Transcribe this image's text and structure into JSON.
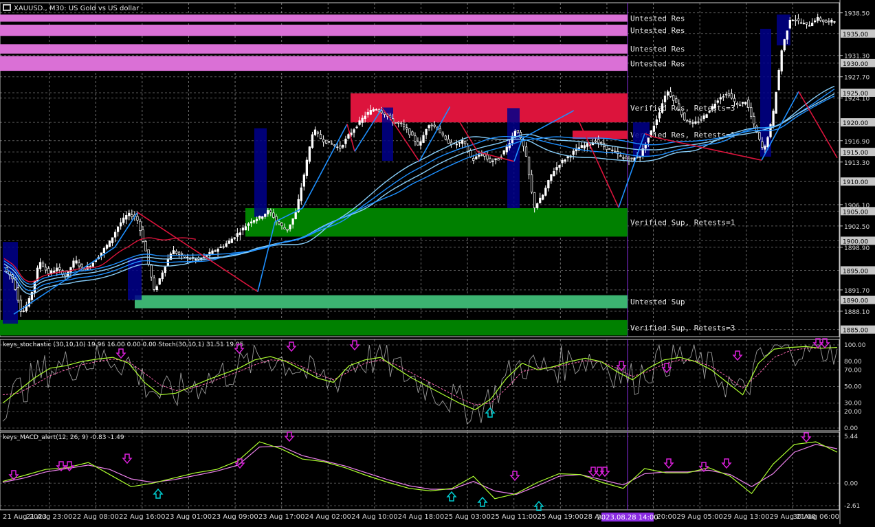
{
  "header": {
    "symbol_line": "XAUUSD., M30:  US Gold vs US dollar"
  },
  "colors": {
    "background": "#000000",
    "grid": "#c8c8c8",
    "candle": "#ffffff",
    "zone_untested_res": "#da70d6",
    "zone_verified_res": "#dc143c",
    "zone_verified_sup": "#008000",
    "zone_untested_sup": "#3cb371",
    "zigzag_up": "#1e90ff",
    "zigzag_down": "#dc143c",
    "ma_blue": "#1e90ff",
    "ma_light": "#87cefa",
    "ma_red": "#dc143c",
    "highlight_box": "#00008b",
    "stoch_main": "#adff2f",
    "stoch_signal": "#ff69b4",
    "stoch_raw": "#c0c0c0",
    "macd_main": "#adff2f",
    "macd_signal": "#ee82ee",
    "arrow_down": "#da20da",
    "arrow_up": "#00ced1",
    "price_label_bg": "#c8c8c8",
    "time_highlight": "#8a2be2"
  },
  "chart_data": [
    {
      "type": "candlestick",
      "title": "XAUUSD., M30:  US Gold vs US dollar",
      "ylim": [
        1883.8,
        1940.2
      ],
      "y_tick_labels": [
        "1938.50",
        "1935.00",
        "1931.30",
        "1930.00",
        "1927.70",
        "1925.00",
        "1924.10",
        "1920.00",
        "1916.90",
        "1915.00",
        "1913.30",
        "1910.00",
        "1906.10",
        "1905.00",
        "1902.50",
        "1900.00",
        "1898.90",
        "1895.00",
        "1891.70",
        "1890.00",
        "1888.10",
        "1885.00"
      ],
      "x_tick_labels": [
        "21 Aug 2023",
        "21 Aug 23:00",
        "22 Aug 08:00",
        "22 Aug 16:00",
        "23 Aug 01:00",
        "23 Aug 09:00",
        "23 Aug 17:00",
        "24 Aug 02:00",
        "24 Aug 10:00",
        "24 Aug 18:00",
        "25 Aug 03:00",
        "25 Aug 11:00",
        "25 Aug 19:00",
        "28 Aug 04:00",
        "28 Aug 20:00",
        "29 Aug 05:00",
        "29 Aug 13:00",
        "29 Aug 21:00",
        "30 Aug 06:00"
      ],
      "highlighted_time_label": "2023.08.28 14:00",
      "zones": [
        {
          "label": "Untested Res",
          "low": 1937.0,
          "high": 1938.2,
          "kind": "untested_res"
        },
        {
          "label": "Untested Res",
          "low": 1934.6,
          "high": 1936.5,
          "kind": "untested_res"
        },
        {
          "label": "Untested Res",
          "low": 1931.6,
          "high": 1933.2,
          "kind": "untested_res"
        },
        {
          "label": "Untested Res",
          "low": 1928.7,
          "high": 1931.2,
          "kind": "untested_res"
        },
        {
          "label": "Verified Res, Retests=3",
          "low": 1920.0,
          "high": 1924.9,
          "kind": "verified_res"
        },
        {
          "label": "Verified Res, Retests=1",
          "low": 1917.2,
          "high": 1918.6,
          "kind": "verified_res"
        },
        {
          "label": "Verified Sup, Retests=1",
          "low": 1900.7,
          "high": 1905.5,
          "kind": "verified_sup"
        },
        {
          "label": "Untested Sup",
          "low": 1888.6,
          "high": 1890.8,
          "kind": "untested_sup"
        },
        {
          "label": "Verified Sup, Retests=3",
          "low": 1884.0,
          "high": 1886.6,
          "kind": "verified_sup"
        }
      ],
      "price_path": [
        1895.5,
        1893.5,
        1887.6,
        1890.5,
        1896.6,
        1894.5,
        1895.3,
        1894.0,
        1896.8,
        1895.0,
        1896.2,
        1898.0,
        1899.9,
        1902.7,
        1904.5,
        1904.0,
        1898.5,
        1891.4,
        1895.0,
        1898.4,
        1897.5,
        1897.0,
        1896.8,
        1897.6,
        1898.5,
        1899.3,
        1900.6,
        1902.0,
        1903.4,
        1904.0,
        1905.1,
        1903.0,
        1901.7,
        1904.6,
        1911.5,
        1918.9,
        1917.0,
        1916.4,
        1915.6,
        1917.8,
        1919.6,
        1921.4,
        1922.4,
        1921.6,
        1920.1,
        1919.6,
        1918.0,
        1916.0,
        1919.8,
        1919.1,
        1916.9,
        1916.2,
        1916.8,
        1913.5,
        1914.8,
        1913.4,
        1913.8,
        1916.0,
        1919.1,
        1915.0,
        1905.6,
        1907.7,
        1911.4,
        1913.2,
        1914.4,
        1915.7,
        1916.2,
        1916.9,
        1915.8,
        1915.1,
        1914.0,
        1913.7,
        1914.4,
        1917.6,
        1921.0,
        1925.4,
        1923.5,
        1920.5,
        1919.7,
        1920.6,
        1922.3,
        1924.3,
        1924.8,
        1922.8,
        1923.6,
        1919.0,
        1915.0,
        1920.8,
        1932.0,
        1937.6,
        1937.0,
        1936.3,
        1937.6,
        1936.9,
        1937.1
      ],
      "zigzag_points": [
        [
          1887.6,
          1898.9
        ],
        [
          1904.8,
          1891.4
        ],
        [
          1903.2,
          1905.5
        ],
        [
          1919.7,
          1915.1
        ],
        [
          1922.4,
          1920.0
        ],
        [
          1913.4,
          1922.7
        ],
        [
          1915.0,
          1913.4
        ],
        [
          1917.3,
          1922.0
        ],
        [
          1905.6,
          1918.1
        ],
        [
          1917.5,
          1913.6
        ],
        [
          1925.2,
          1914.0
        ],
        [
          1938.0,
          1935.9
        ]
      ]
    },
    {
      "type": "line",
      "title": "keys_stochastic (30,10,10) 19.96 16.00 0.00 0.00 Stoch(30,10,1) 31.51 19.95",
      "ylim": [
        0,
        100
      ],
      "y_tick_labels": [
        "100.00",
        "80.00",
        "70.00",
        "50.00",
        "30.00",
        "20.00",
        "0.00"
      ],
      "series": [
        {
          "name": "main",
          "values": [
            30,
            45,
            60,
            72,
            75,
            80,
            83,
            85,
            78,
            55,
            40,
            42,
            50,
            58,
            65,
            72,
            82,
            86,
            80,
            70,
            60,
            55,
            75,
            82,
            85,
            72,
            60,
            50,
            40,
            30,
            22,
            35,
            60,
            78,
            70,
            74,
            80,
            84,
            80,
            68,
            58,
            72,
            82,
            85,
            80,
            70,
            55,
            40,
            78,
            95,
            97,
            98,
            96,
            97
          ]
        },
        {
          "name": "signal",
          "values": [
            40,
            42,
            52,
            63,
            70,
            76,
            80,
            83,
            80,
            66,
            52,
            45,
            48,
            54,
            61,
            68,
            76,
            82,
            81,
            74,
            65,
            58,
            68,
            78,
            82,
            76,
            66,
            56,
            46,
            36,
            28,
            30,
            48,
            68,
            72,
            73,
            77,
            81,
            80,
            72,
            62,
            68,
            77,
            82,
            81,
            74,
            62,
            48,
            65,
            85,
            93,
            96,
            96,
            97
          ]
        }
      ],
      "down_arrow_count": 12,
      "up_arrow_count": 1
    },
    {
      "type": "line",
      "title": "keys_MACD_alert(12, 26, 9) -0.83 -1.49",
      "ylim": [
        -2.61,
        5.44
      ],
      "y_tick_labels": [
        "5.44",
        "0.00",
        "-2.61"
      ],
      "series": [
        {
          "name": "main",
          "values": [
            0.2,
            0.9,
            1.6,
            1.8,
            2.4,
            1.0,
            -0.4,
            0.0,
            0.6,
            1.2,
            1.6,
            2.6,
            4.8,
            4.0,
            2.8,
            2.5,
            1.8,
            0.9,
            0.1,
            -0.6,
            -0.9,
            -0.6,
            0.8,
            -1.8,
            -1.2,
            0.1,
            1.1,
            1.0,
            0.1,
            -0.6,
            1.7,
            1.2,
            1.2,
            1.8,
            0.8,
            -1.2,
            2.2,
            4.5,
            4.8,
            3.6
          ]
        },
        {
          "name": "signal",
          "values": [
            0.1,
            0.6,
            1.3,
            1.7,
            2.1,
            1.6,
            0.5,
            0.1,
            0.4,
            0.9,
            1.4,
            2.1,
            4.2,
            4.3,
            3.2,
            2.6,
            2.0,
            1.2,
            0.4,
            -0.3,
            -0.7,
            -0.7,
            0.2,
            -0.9,
            -1.3,
            -0.3,
            0.8,
            1.0,
            0.4,
            -0.2,
            1.1,
            1.3,
            1.3,
            1.5,
            1.0,
            -0.4,
            1.1,
            3.6,
            4.5,
            4.0
          ]
        }
      ],
      "down_arrow_count": 15,
      "up_arrow_count": 4
    }
  ]
}
